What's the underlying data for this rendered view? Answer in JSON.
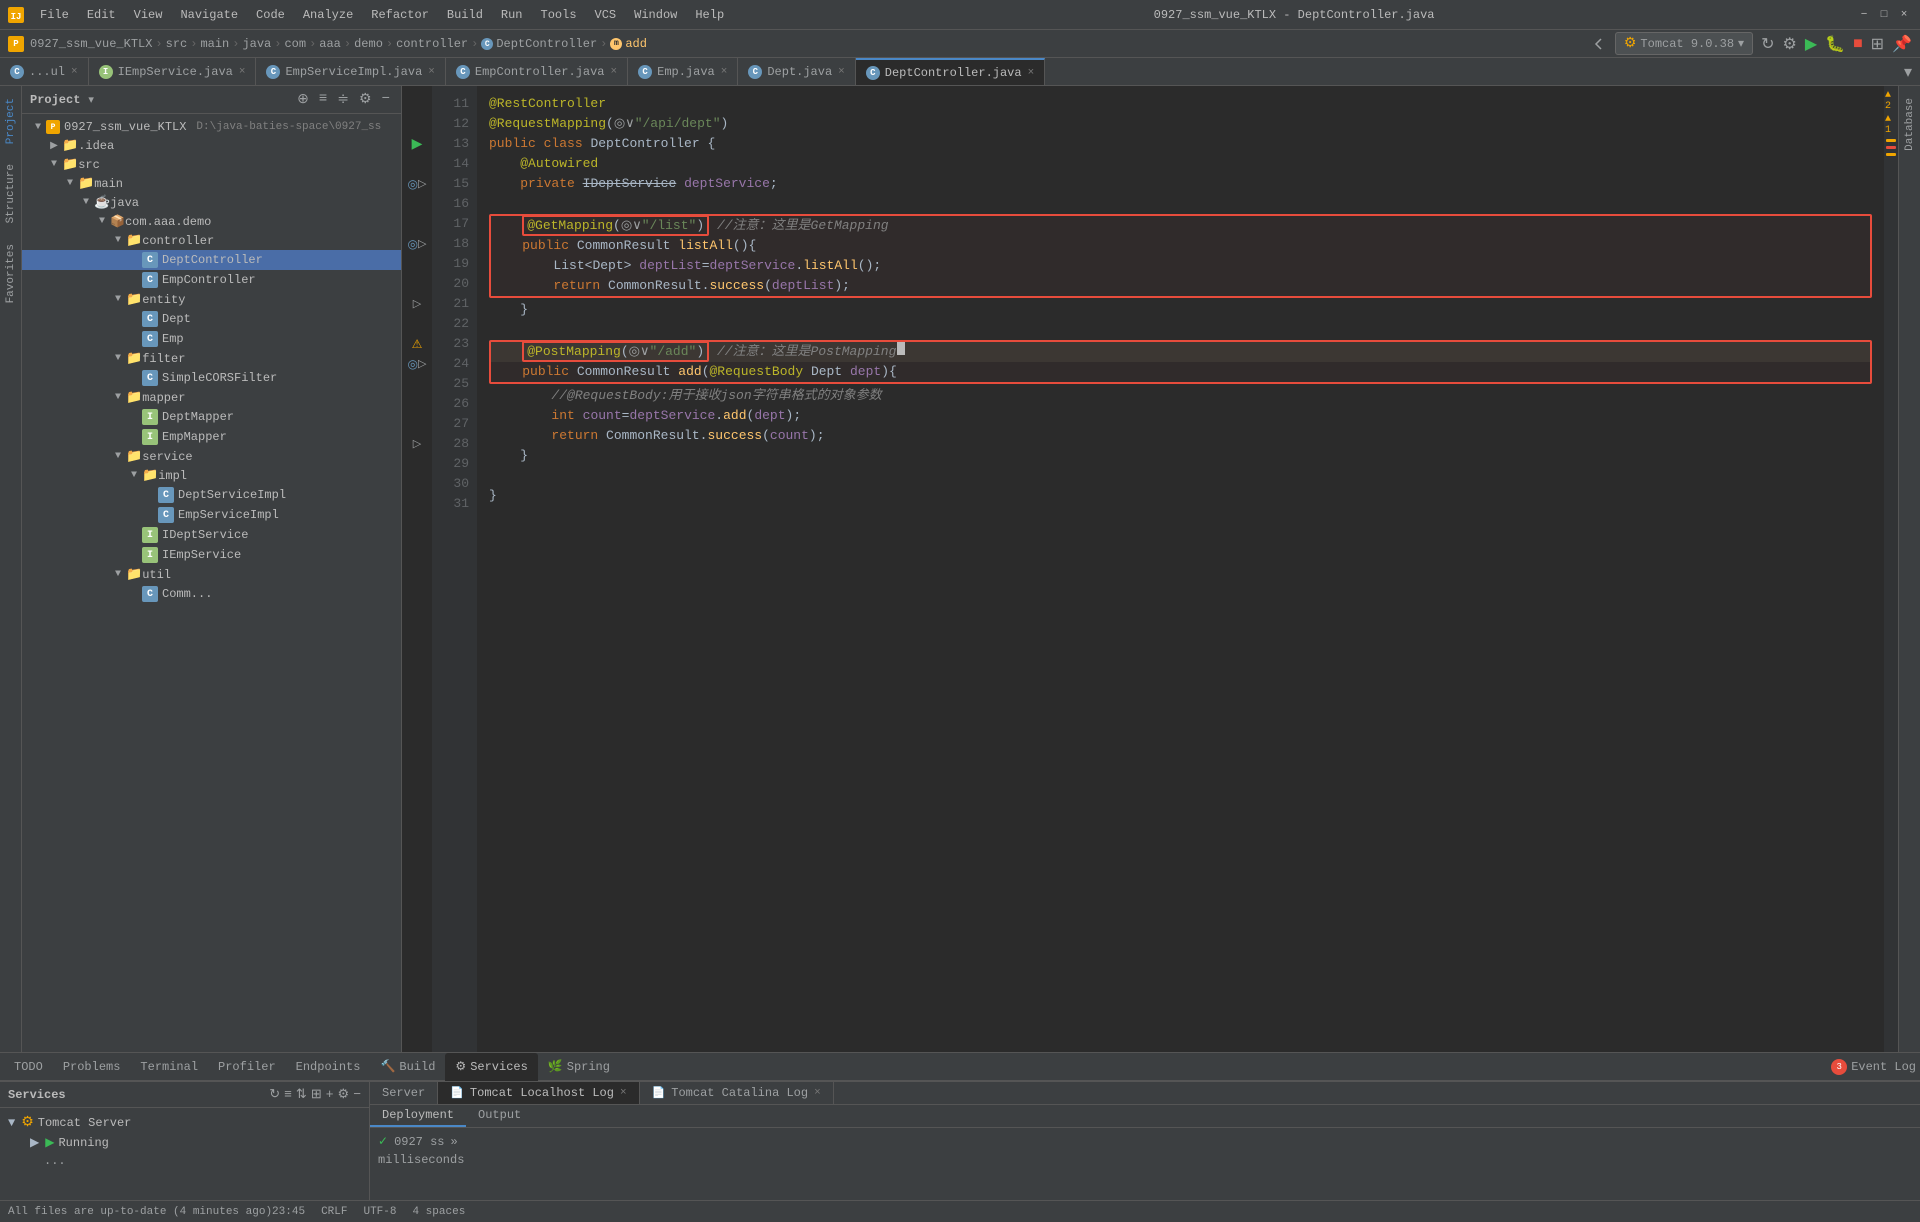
{
  "titlebar": {
    "app_name": "IDEA",
    "title": "0927_ssm_vue_KTLX - DeptController.java",
    "menu": [
      "File",
      "Edit",
      "View",
      "Navigate",
      "Code",
      "Analyze",
      "Refactor",
      "Build",
      "Run",
      "Tools",
      "VCS",
      "Window",
      "Help"
    ],
    "tomcat_btn": "Tomcat 9.0.38"
  },
  "breadcrumb": {
    "project": "0927_ssm_vue_KTLX",
    "path": [
      "src",
      "main",
      "java",
      "com",
      "aaa",
      "demo",
      "controller"
    ],
    "class": "DeptController",
    "method": "add"
  },
  "tabs": [
    {
      "label": "...ul",
      "icon": "c",
      "active": false,
      "closable": true
    },
    {
      "label": "IEmpService.java",
      "icon": "i",
      "active": false,
      "closable": true
    },
    {
      "label": "EmpServiceImpl.java",
      "icon": "c",
      "active": false,
      "closable": true
    },
    {
      "label": "EmpController.java",
      "icon": "c",
      "active": false,
      "closable": true
    },
    {
      "label": "Emp.java",
      "icon": "c",
      "active": false,
      "closable": true
    },
    {
      "label": "Dept.java",
      "icon": "c",
      "active": false,
      "closable": true
    },
    {
      "label": "DeptController.java",
      "icon": "c",
      "active": true,
      "closable": true
    }
  ],
  "sidebar": {
    "title": "Project",
    "project_name": "0927_ssm_vue_KTLX",
    "project_path": "D:\\java-baties-space\\0927_ss",
    "tree": [
      {
        "indent": 0,
        "type": "folder",
        "label": ".idea",
        "expanded": false
      },
      {
        "indent": 0,
        "type": "folder",
        "label": "src",
        "expanded": true
      },
      {
        "indent": 1,
        "type": "folder",
        "label": "main",
        "expanded": true
      },
      {
        "indent": 2,
        "type": "folder",
        "label": "java",
        "expanded": true
      },
      {
        "indent": 3,
        "type": "package",
        "label": "com.aaa.demo",
        "expanded": true
      },
      {
        "indent": 4,
        "type": "folder",
        "label": "controller",
        "expanded": true,
        "selected": false
      },
      {
        "indent": 5,
        "type": "class",
        "label": "DeptController",
        "selected": true
      },
      {
        "indent": 5,
        "type": "class",
        "label": "EmpController",
        "selected": false
      },
      {
        "indent": 4,
        "type": "folder",
        "label": "entity",
        "expanded": true
      },
      {
        "indent": 5,
        "type": "class",
        "label": "Dept"
      },
      {
        "indent": 5,
        "type": "class",
        "label": "Emp"
      },
      {
        "indent": 4,
        "type": "folder",
        "label": "filter",
        "expanded": true
      },
      {
        "indent": 5,
        "type": "class",
        "label": "SimpleCORSFilter"
      },
      {
        "indent": 4,
        "type": "folder",
        "label": "mapper",
        "expanded": true
      },
      {
        "indent": 5,
        "type": "iface",
        "label": "DeptMapper"
      },
      {
        "indent": 5,
        "type": "iface",
        "label": "EmpMapper"
      },
      {
        "indent": 4,
        "type": "folder",
        "label": "service",
        "expanded": true
      },
      {
        "indent": 5,
        "type": "folder",
        "label": "impl",
        "expanded": true
      },
      {
        "indent": 6,
        "type": "class",
        "label": "DeptServiceImpl"
      },
      {
        "indent": 6,
        "type": "class",
        "label": "EmpServiceImpl"
      },
      {
        "indent": 5,
        "type": "iface",
        "label": "IDeptService"
      },
      {
        "indent": 5,
        "type": "iface",
        "label": "IEmpService"
      },
      {
        "indent": 4,
        "type": "folder",
        "label": "util",
        "expanded": true
      },
      {
        "indent": 5,
        "type": "class",
        "label": "Comm..."
      }
    ]
  },
  "code": {
    "lines": [
      {
        "num": 11,
        "content": "@RestController",
        "type": "annotation"
      },
      {
        "num": 12,
        "content": "@RequestMapping(\"◎∨\"/api/dept\"\")",
        "type": "annotation"
      },
      {
        "num": 13,
        "content": "public class DeptController {",
        "type": "code"
      },
      {
        "num": 14,
        "content": "    @Autowired",
        "type": "annotation"
      },
      {
        "num": 15,
        "content": "    private IDeptService deptService;",
        "type": "code"
      },
      {
        "num": 16,
        "content": "",
        "type": "empty"
      },
      {
        "num": 17,
        "content": "    @GetMapping(\"◎∨\"/list\"\") //注意：这里是GetMapping",
        "type": "annotation_highlighted"
      },
      {
        "num": 18,
        "content": "    public CommonResult listAll(){",
        "type": "code"
      },
      {
        "num": 19,
        "content": "        List<Dept> deptList=deptService.listAll();",
        "type": "code"
      },
      {
        "num": 20,
        "content": "        return CommonResult.success(deptList);",
        "type": "code"
      },
      {
        "num": 21,
        "content": "    }",
        "type": "code"
      },
      {
        "num": 22,
        "content": "",
        "type": "empty"
      },
      {
        "num": 23,
        "content": "    @PostMapping(\"◎∨\"/add\"\") //注意：这里是PostMapping",
        "type": "annotation_highlighted",
        "warning": true
      },
      {
        "num": 24,
        "content": "    public CommonResult add(@RequestBody Dept dept){",
        "type": "code"
      },
      {
        "num": 25,
        "content": "        //@RequestBody:用于接收json字符串格式的对象参数",
        "type": "comment"
      },
      {
        "num": 26,
        "content": "        int count=deptService.add(dept);",
        "type": "code"
      },
      {
        "num": 27,
        "content": "        return CommonResult.success(count);",
        "type": "code"
      },
      {
        "num": 28,
        "content": "    }",
        "type": "code"
      },
      {
        "num": 29,
        "content": "",
        "type": "empty"
      },
      {
        "num": 30,
        "content": "}",
        "type": "code"
      },
      {
        "num": 31,
        "content": "",
        "type": "empty"
      }
    ]
  },
  "services_panel": {
    "title": "Services",
    "tomcat_server": "Tomcat Server",
    "running_label": "Running",
    "server_tabs": [
      "Server",
      "Tomcat Localhost Log",
      "Tomcat Catalina Log"
    ],
    "deploy_tabs": [
      "Deployment",
      "Output"
    ],
    "output_text": "milliseconds",
    "deployment_item": "0927 ss"
  },
  "bottom_tool_tabs": [
    {
      "label": "TODO",
      "icon": null,
      "active": false
    },
    {
      "label": "Problems",
      "icon": null,
      "active": false
    },
    {
      "label": "Terminal",
      "icon": null,
      "active": false
    },
    {
      "label": "Profiler",
      "icon": null,
      "active": false
    },
    {
      "label": "Endpoints",
      "icon": null,
      "active": false
    },
    {
      "label": "Build",
      "icon": null,
      "active": false
    },
    {
      "label": "Services",
      "icon": "gear",
      "active": true
    },
    {
      "label": "Spring",
      "icon": null,
      "active": false
    }
  ],
  "status_bar": {
    "message": "All files are up-to-date (4 minutes ago)",
    "line_col": "23:45",
    "encoding": "CRLF",
    "charset": "UTF-8",
    "indent": "4 spaces",
    "warnings": "▲ 2",
    "errors": "▲ 1",
    "event_log": "Event Log"
  },
  "icons": {
    "folder": "▶",
    "folder_open": "▼",
    "run": "▶",
    "close": "×",
    "warning": "⚠",
    "error": "●",
    "settings": "⚙",
    "refresh": "↻",
    "arrow_right": "❯",
    "arrow_down": "❯"
  }
}
